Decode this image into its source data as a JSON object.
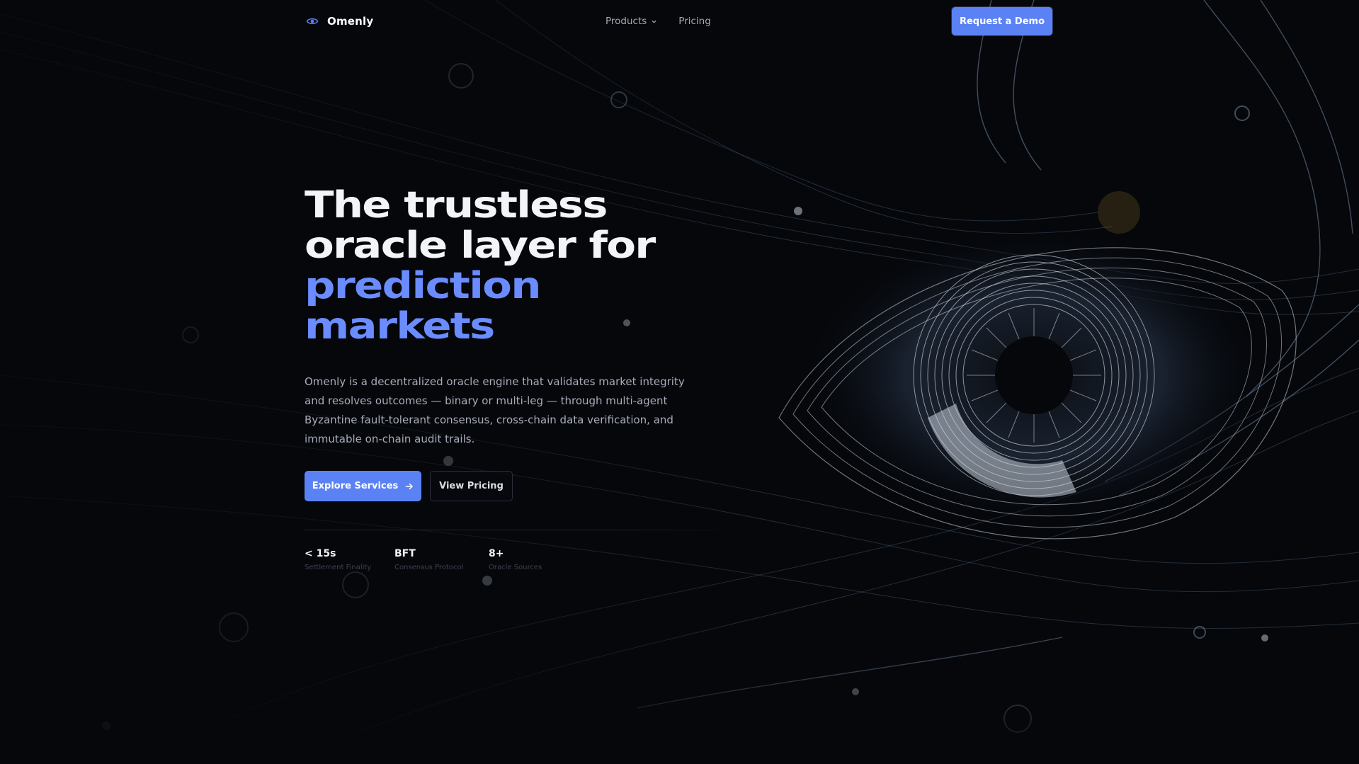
{
  "nav": {
    "brand": "Omenly",
    "links": [
      {
        "label": "Products",
        "has_dropdown": true
      },
      {
        "label": "Pricing",
        "has_dropdown": false
      }
    ],
    "cta_label": "Request a Demo"
  },
  "hero": {
    "headline_lines": [
      "The trustless",
      "oracle layer for",
      "prediction",
      "markets"
    ],
    "accent_color": "#6b8cff",
    "description": "Omenly is a decentralized oracle engine that validates market integrity and resolves outcomes — binary or multi-leg — through multi-agent Byzantine fault-tolerant consensus, cross-chain data verification, and immutable on-chain audit trails.",
    "primary_cta": "Explore Services",
    "secondary_cta": "View Pricing"
  },
  "stats": [
    {
      "value": "< 15s",
      "label": "Settlement Finality"
    },
    {
      "value": "BFT",
      "label": "Consensus Protocol"
    },
    {
      "value": "8+",
      "label": "Oracle Sources"
    }
  ],
  "colors": {
    "background": "#05070b",
    "button": "#5b82f5",
    "art_line": "#7f9ab8"
  },
  "icons": {
    "brand": "eye-icon",
    "products_chevron": "chevron-down-icon",
    "primary_arrow": "arrow-right-icon"
  }
}
